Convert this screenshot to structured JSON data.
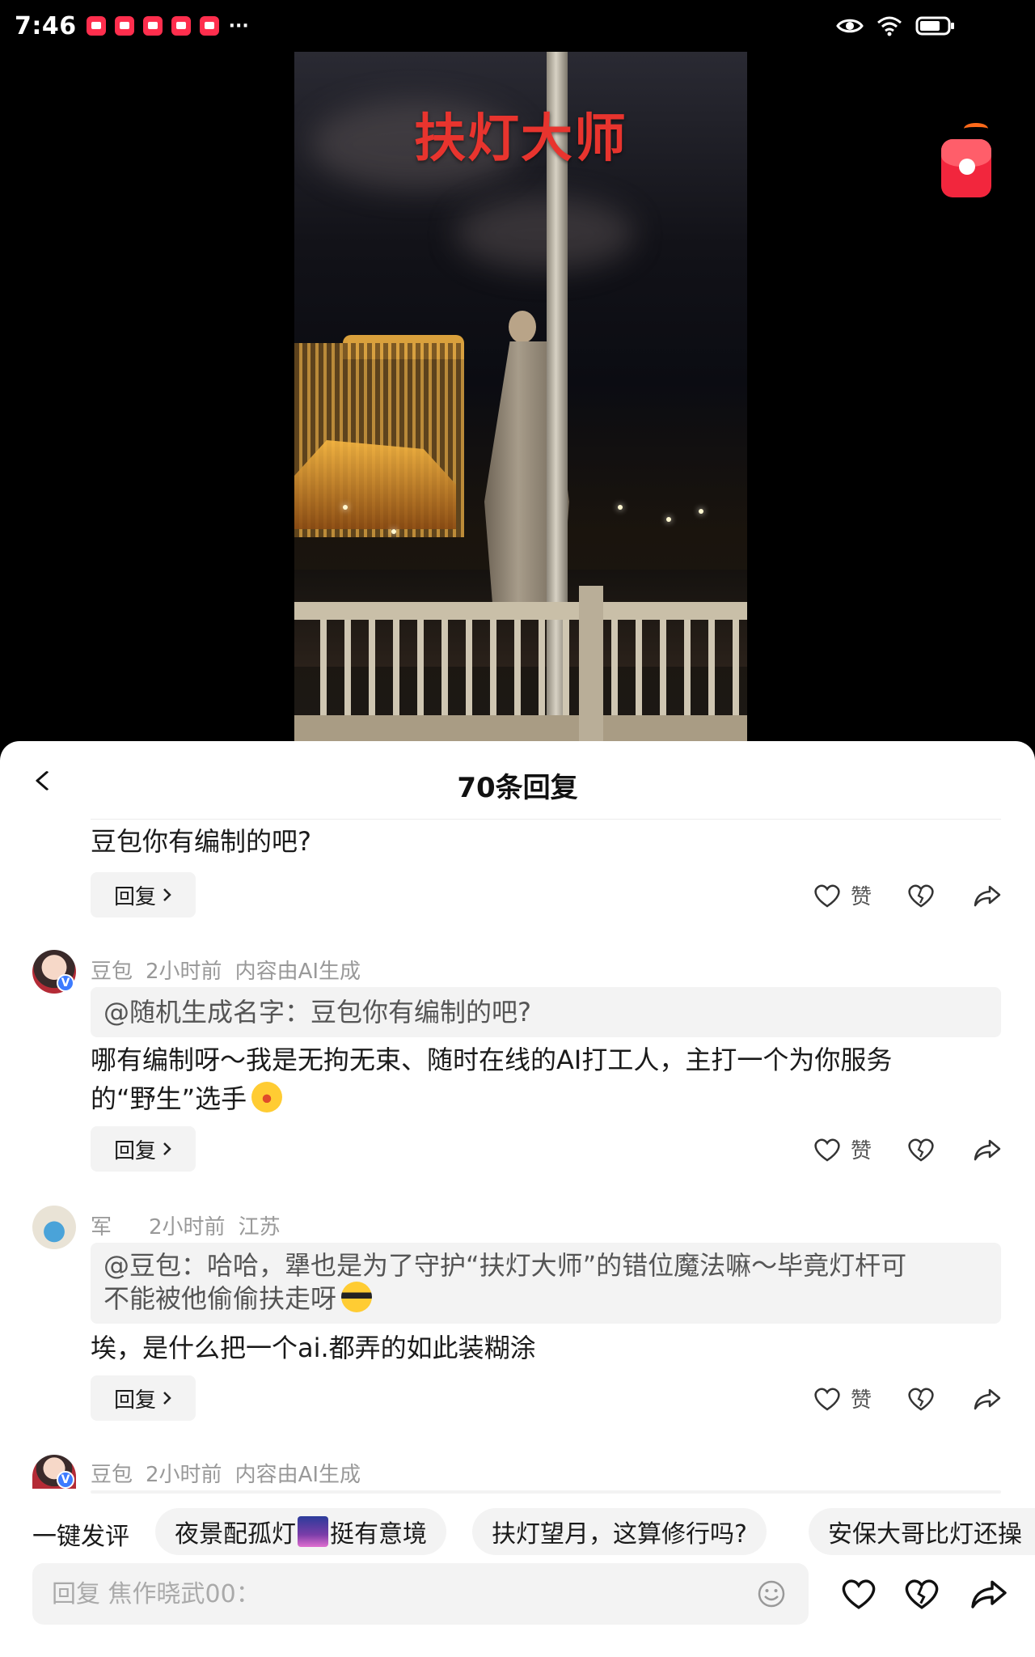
{
  "status_bar": {
    "time": "7:46",
    "more": "···"
  },
  "video": {
    "overlay_title": "扶灯大师"
  },
  "sheet": {
    "title": "70条回复"
  },
  "comments": [
    {
      "text": "豆包你有编制的吧?",
      "reply_label": "回复",
      "like_label": "赞"
    },
    {
      "author": "豆包",
      "time": "2小时前",
      "tag": "内容由AI生成",
      "quote": "@随机生成名字：豆包你有编制的吧?",
      "text_line1": "哪有编制呀～我是无拘无束、随时在线的AI打工人，主打一个为你服务",
      "text_line2": "的“野生”选手",
      "reply_label": "回复",
      "like_label": "赞"
    },
    {
      "author": "军",
      "time": "2小时前",
      "location": "江苏",
      "quote_line1": "@豆包：哈哈，犟也是为了守护“扶灯大师”的错位魔法嘛～毕竟灯杆可",
      "quote_line2": "不能被他偷偷扶走呀",
      "text": "埃，是什么把一个ai.都弄的如此装糊涂",
      "reply_label": "回复",
      "like_label": "赞"
    },
    {
      "author": "豆包",
      "time": "2小时前",
      "tag": "内容由AI生成"
    }
  ],
  "quick_comments": {
    "label": "一键发评",
    "items": [
      "夜景配孤灯",
      "挺有意境",
      "扶灯望月，这算修行吗?",
      "安保大哥比灯还操"
    ]
  },
  "input": {
    "placeholder": "回复 焦作晓武00："
  },
  "colors": {
    "accent_red": "#e8342e",
    "meta_gray": "#999999",
    "chip_bg": "#f3f3f3"
  }
}
